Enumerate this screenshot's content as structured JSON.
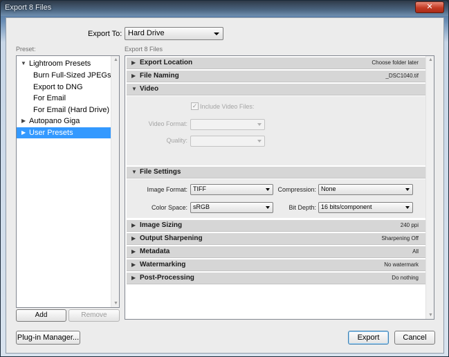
{
  "window": {
    "title": "Export 8 Files",
    "close_glyph": "✕"
  },
  "export_to": {
    "label": "Export To:",
    "value": "Hard Drive"
  },
  "preset": {
    "label": "Preset:",
    "lightroom_presets": "Lightroom Presets",
    "items": [
      "Burn Full-Sized JPEGs",
      "Export to DNG",
      "For Email",
      "For Email (Hard Drive)"
    ],
    "autopano": "Autopano Giga",
    "user_presets": "User Presets",
    "add_label": "Add",
    "remove_label": "Remove"
  },
  "export_files_label": "Export 8 Files",
  "sections": {
    "export_location": {
      "title": "Export Location",
      "summary": "Choose folder later"
    },
    "file_naming": {
      "title": "File Naming",
      "summary": "_DSC1040.tif"
    },
    "video": {
      "title": "Video",
      "include_label": "Include Video Files:",
      "format_label": "Video Format:",
      "quality_label": "Quality:",
      "format_value": "",
      "quality_value": ""
    },
    "file_settings": {
      "title": "File Settings",
      "image_format_label": "Image Format:",
      "image_format_value": "TIFF",
      "compression_label": "Compression:",
      "compression_value": "None",
      "color_space_label": "Color Space:",
      "color_space_value": "sRGB",
      "bit_depth_label": "Bit Depth:",
      "bit_depth_value": "16 bits/component"
    },
    "image_sizing": {
      "title": "Image Sizing",
      "summary": "240 ppi"
    },
    "output_sharpening": {
      "title": "Output Sharpening",
      "summary": "Sharpening Off"
    },
    "metadata": {
      "title": "Metadata",
      "summary": "All"
    },
    "watermarking": {
      "title": "Watermarking",
      "summary": "No watermark"
    },
    "post_processing": {
      "title": "Post-Processing",
      "summary": "Do nothing"
    }
  },
  "footer": {
    "plugin_manager_label": "Plug-in Manager...",
    "export_label": "Export",
    "cancel_label": "Cancel"
  },
  "glyphs": {
    "collapsed": "▶",
    "expanded": "▼",
    "up": "▲",
    "down": "▼",
    "check": "✓"
  },
  "colors": {
    "selection": "#3399ff",
    "section_header": "#d6d6d6"
  }
}
